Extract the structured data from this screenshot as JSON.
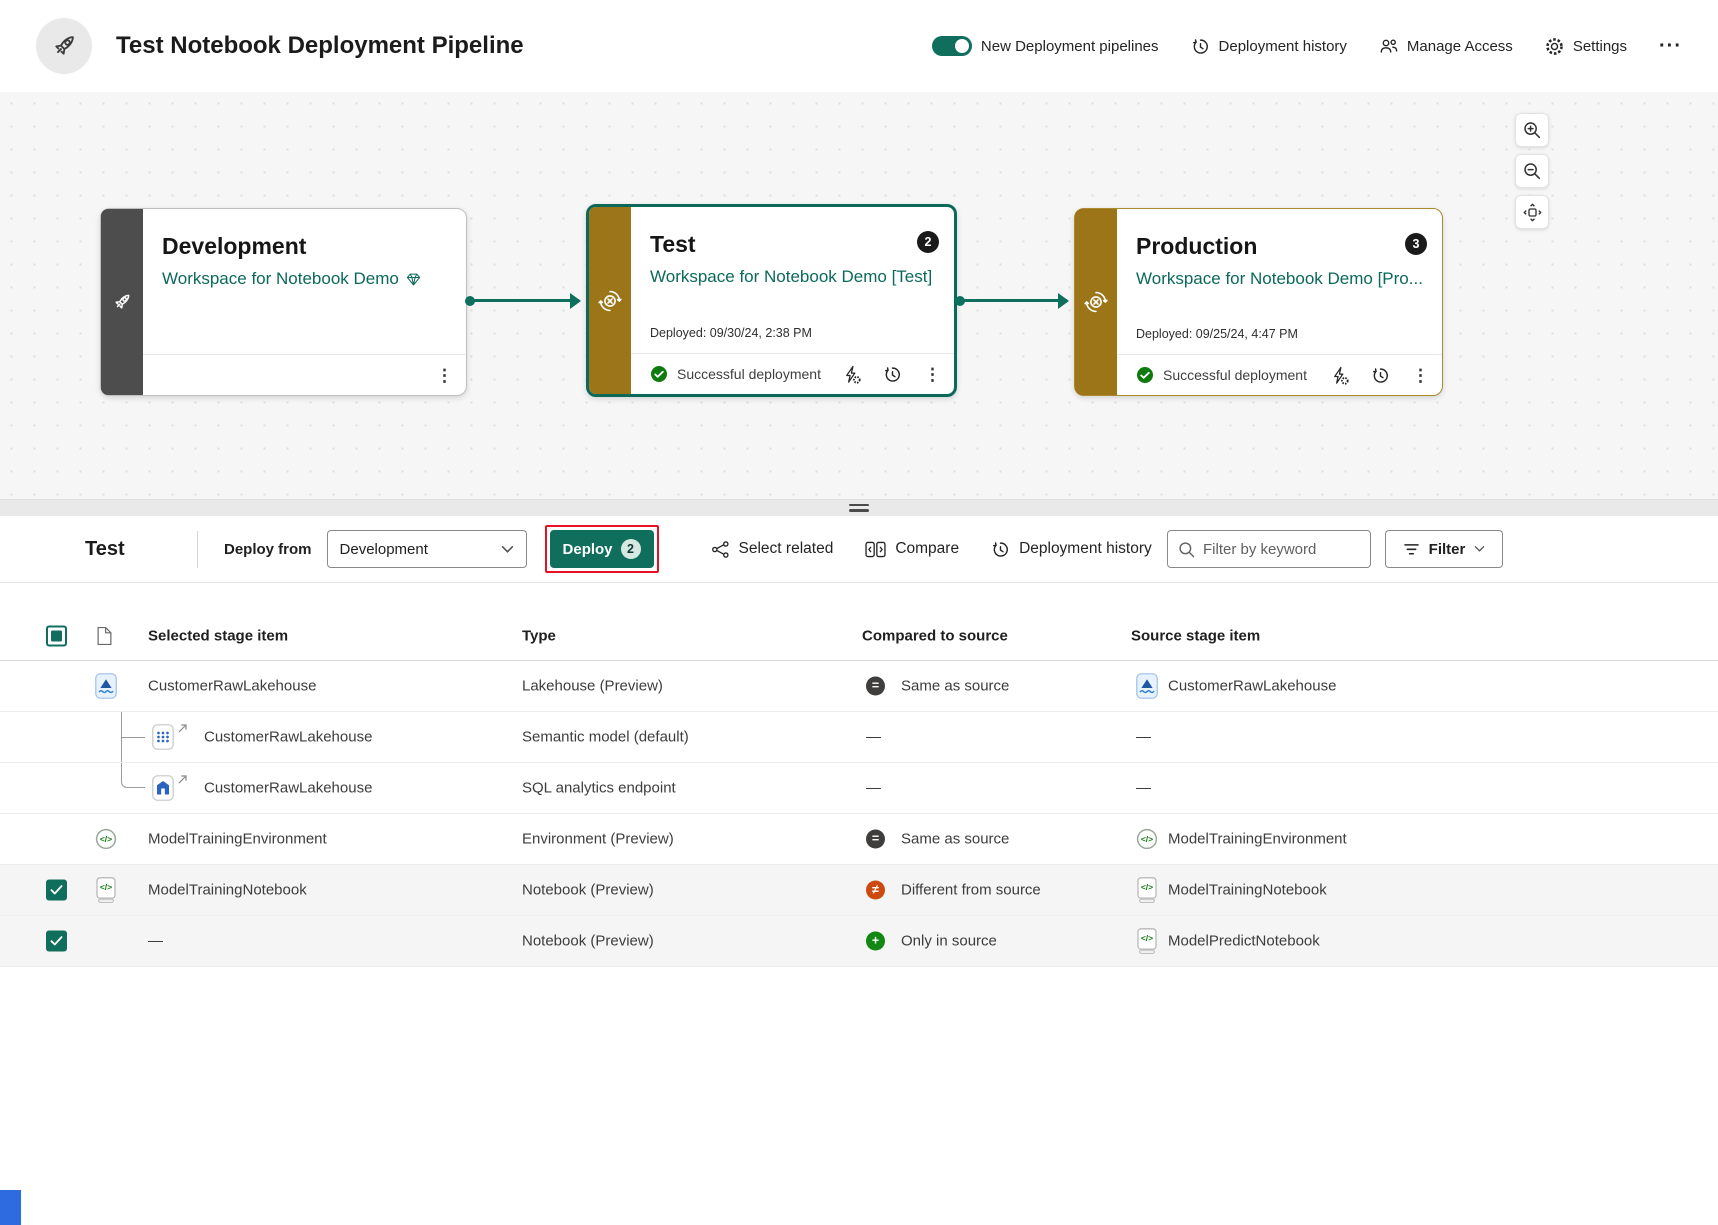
{
  "header": {
    "title": "Test Notebook Deployment Pipeline",
    "toggle": {
      "label": "New Deployment pipelines",
      "state": "on"
    },
    "actions": [
      {
        "icon": "history-icon",
        "label": "Deployment history"
      },
      {
        "icon": "people-icon",
        "label": "Manage Access"
      },
      {
        "icon": "gear-icon",
        "label": "Settings"
      },
      {
        "icon": "more-icon",
        "label": "···"
      }
    ]
  },
  "canvas": {
    "stages": [
      {
        "name": "Development",
        "workspace": "Workspace for Notebook Demo",
        "badge": "",
        "deployed": "",
        "status": ""
      },
      {
        "name": "Test",
        "workspace": "Workspace for Notebook Demo [Test]",
        "badge": "2",
        "deployed": "Deployed: 09/30/24, 2:38 PM",
        "status": "Successful deployment"
      },
      {
        "name": "Production",
        "workspace": "Workspace for Notebook Demo [Pro...",
        "badge": "3",
        "deployed": "Deployed: 09/25/24, 4:47 PM",
        "status": "Successful deployment"
      }
    ],
    "zoom_controls": [
      "zoom-in-icon",
      "zoom-out-icon",
      "fit-to-screen-icon"
    ]
  },
  "toolbar": {
    "stage_name": "Test",
    "deploy_from_label": "Deploy from",
    "deploy_from_value": "Development",
    "deploy_label": "Deploy",
    "deploy_badge": "2",
    "select_related_label": "Select related",
    "compare_label": "Compare",
    "history_label": "Deployment history",
    "search_placeholder": "Filter by keyword",
    "filter_label": "Filter"
  },
  "table": {
    "columns": [
      "Selected stage item",
      "Type",
      "Compared to source",
      "Source stage item"
    ],
    "rows": [
      {
        "checked": false,
        "icon": "lakehouse-icon",
        "tree": null,
        "related": false,
        "name": "CustomerRawLakehouse",
        "type": "Lakehouse (Preview)",
        "compare_status": "same",
        "compare_label": "Same as source",
        "source_icon": "lakehouse-icon",
        "source_name": "CustomerRawLakehouse",
        "highlight": false
      },
      {
        "checked": false,
        "icon": "semantic-model-icon",
        "tree": "pass",
        "related": true,
        "name": "CustomerRawLakehouse",
        "type": "Semantic model (default)",
        "compare_status": "none",
        "compare_label": "—",
        "source_icon": null,
        "source_name": "—",
        "highlight": false
      },
      {
        "checked": false,
        "icon": "sql-endpoint-icon",
        "tree": "end",
        "related": true,
        "name": "CustomerRawLakehouse",
        "type": "SQL analytics endpoint",
        "compare_status": "none",
        "compare_label": "—",
        "source_icon": null,
        "source_name": "—",
        "highlight": false
      },
      {
        "checked": false,
        "icon": "environment-icon",
        "tree": null,
        "related": false,
        "name": "ModelTrainingEnvironment",
        "type": "Environment (Preview)",
        "compare_status": "same",
        "compare_label": "Same as source",
        "source_icon": "environment-icon",
        "source_name": "ModelTrainingEnvironment",
        "highlight": false
      },
      {
        "checked": true,
        "icon": "notebook-icon",
        "tree": null,
        "related": false,
        "name": "ModelTrainingNotebook",
        "type": "Notebook (Preview)",
        "compare_status": "different",
        "compare_label": "Different from source",
        "source_icon": "notebook-icon",
        "source_name": "ModelTrainingNotebook",
        "highlight": true
      },
      {
        "checked": true,
        "icon": null,
        "tree": null,
        "related": false,
        "name": "—",
        "type": "Notebook (Preview)",
        "compare_status": "only",
        "compare_label": "Only in source",
        "source_icon": "notebook-icon",
        "source_name": "ModelPredictNotebook",
        "highlight": true
      }
    ]
  },
  "status_glyphs": {
    "same": "=",
    "different": "≠",
    "only": "+"
  },
  "colors": {
    "accent_teal": "#0c695a",
    "strip_gold": "#9b7517",
    "strip_dark": "#4d4d4d",
    "status_same": "#3f3e3d",
    "status_different": "#cc4a10",
    "status_only": "#128712",
    "deploy_highlight_red": "#e81123",
    "success_green": "#0f7b0f"
  }
}
